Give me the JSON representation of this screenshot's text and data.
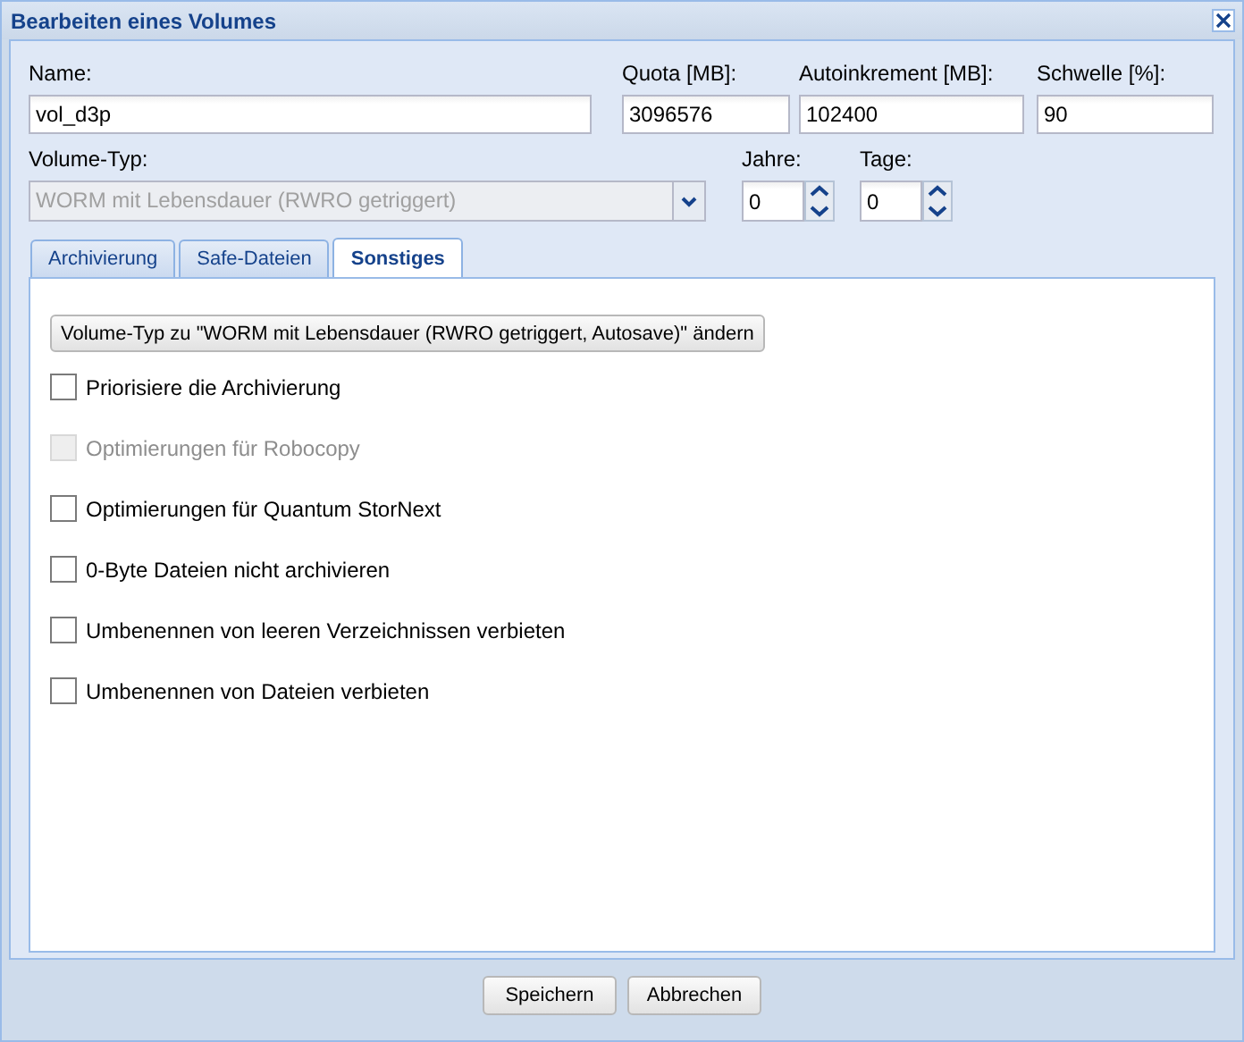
{
  "window": {
    "title": "Bearbeiten eines Volumes"
  },
  "fields_row_1": [
    {
      "label": "Name:",
      "value": "vol_d3p"
    },
    {
      "label": "Quota [MB]:",
      "value": "3096576"
    },
    {
      "label": "Autoinkrement [MB]:",
      "value": "102400"
    },
    {
      "label": "Schwelle [%]:",
      "value": "90"
    }
  ],
  "fields_row_2": [
    {
      "kind": "combo",
      "label": "Volume-Typ:",
      "value": "WORM mit Lebensdauer (RWRO getriggert)",
      "disabled": true
    },
    {
      "kind": "spinner",
      "label": "Jahre:",
      "value": "0"
    },
    {
      "kind": "spinner",
      "label": "Tage:",
      "value": "0"
    }
  ],
  "tabs": [
    {
      "label": "Archivierung",
      "selected": false
    },
    {
      "label": "Safe-Dateien",
      "selected": false
    },
    {
      "label": "Sonstiges",
      "selected": true
    }
  ],
  "panel": {
    "action_button": "Volume-Typ zu \"WORM mit Lebensdauer (RWRO getriggert, Autosave)\" ändern",
    "checkboxes": [
      {
        "label": "Priorisiere die Archivierung",
        "checked": false,
        "disabled": false
      },
      {
        "label": "Optimierungen für Robocopy",
        "checked": false,
        "disabled": true
      },
      {
        "label": "Optimierungen für Quantum StorNext",
        "checked": false,
        "disabled": false
      },
      {
        "label": "0-Byte Dateien nicht archivieren",
        "checked": false,
        "disabled": false
      },
      {
        "label": "Umbenennen von leeren Verzeichnissen verbieten",
        "checked": false,
        "disabled": false
      },
      {
        "label": "Umbenennen von Dateien verbieten",
        "checked": false,
        "disabled": false
      }
    ]
  },
  "buttons": [
    "Speichern",
    "Abbrechen"
  ]
}
